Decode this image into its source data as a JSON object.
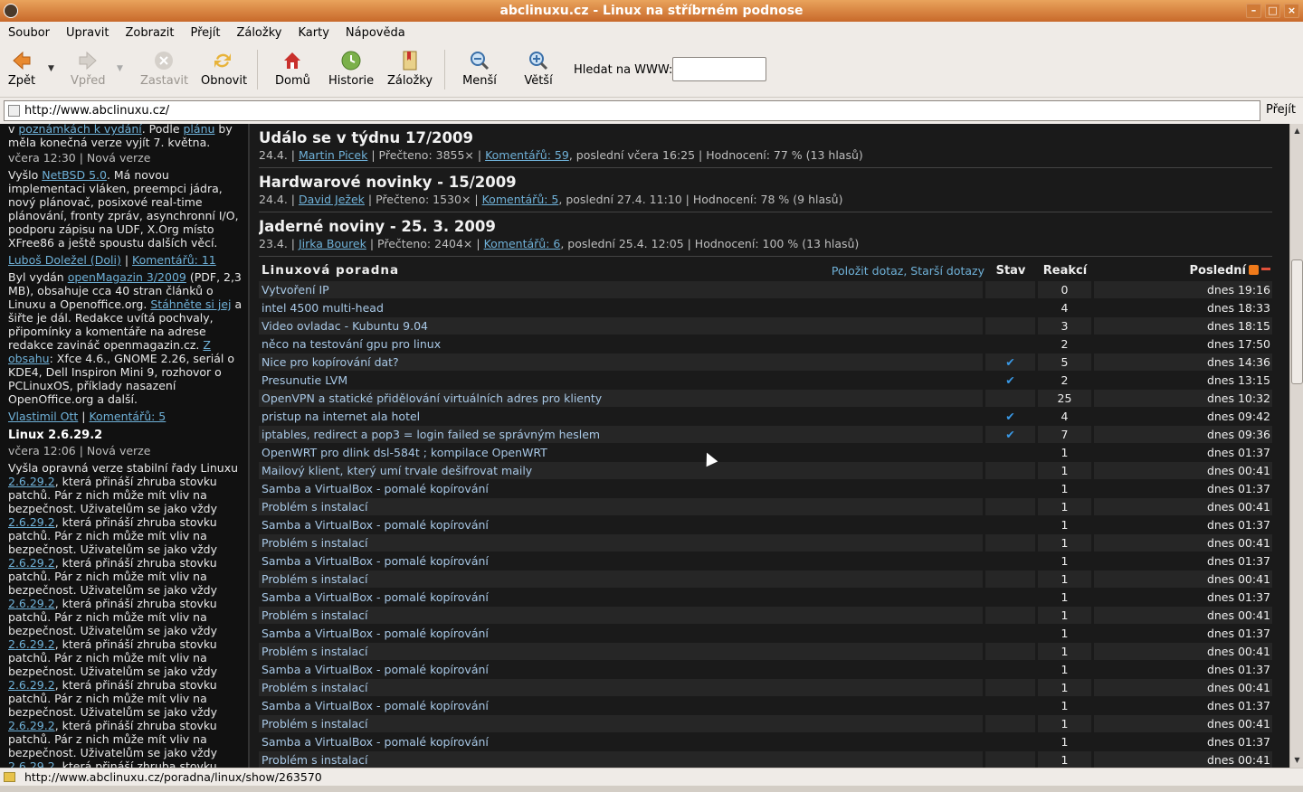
{
  "window": {
    "title": "abclinuxu.cz - Linux na stříbrném podnose"
  },
  "menu": [
    "Soubor",
    "Upravit",
    "Zobrazit",
    "Přejít",
    "Záložky",
    "Karty",
    "Nápověda"
  ],
  "toolbar": {
    "back": "Zpět",
    "forward": "Vpřed",
    "stop": "Zastavit",
    "reload": "Obnovit",
    "home": "Domů",
    "history": "Historie",
    "bookmarks": "Záložky",
    "zoom_out": "Menší",
    "zoom_in": "Větší",
    "search_label": "Hledat na WWW:"
  },
  "address": {
    "url": "http://www.abclinuxu.cz/",
    "go": "Přejít"
  },
  "sidebar": {
    "news1_text_a": "v ",
    "news1_link_a": "poznámkách k vydání",
    "news1_text_b": ". Podle ",
    "news1_link_b": "plánu",
    "news1_text_c": " by měla konečná verze vyjít 7. května.",
    "news1_meta": "včera 12:30 | Nová verze",
    "news2_text_a": "Vyšlo ",
    "news2_link": "NetBSD 5.0",
    "news2_text_b": ". Má novou implementaci vláken, preempci jádra, nový plánovač, posixové real-time plánování, fronty zpráv, asynchronní I/O, podporu zápisu na UDF, X.Org místo XFree86 a ještě spoustu dalších věcí.",
    "news2_author": "Luboš Doležel (Doli)",
    "news2_comments": "Komentářů: 11",
    "news3_text_a": "Byl vydán ",
    "news3_link_a": "openMagazin 3/2009",
    "news3_text_b": " (PDF, 2,3 MB), obsahuje cca 40 stran článků o Linuxu a Openoffice.org. ",
    "news3_link_b": "Stáhněte si jej",
    "news3_text_c": " a šiřte je dál. Redakce uvítá pochvaly, připomínky a komentáře na adrese redakce zavináč openmagazin.cz. ",
    "news3_link_c": "Z obsahu",
    "news3_text_d": ": Xfce 4.6., GNOME 2.26, seriál o KDE4, Dell Inspiron Mini 9, rozhovor o PCLinuxOS, příklady nasazení OpenOffice.org a další.",
    "news3_author": "Vlastimil Ott",
    "news3_comments": "Komentářů: 5",
    "news4_title": "Linux 2.6.29.2",
    "news4_meta": "včera 12:06 | Nová verze",
    "news4_text_a": "Vyšla opravná verze stabilní řady Linuxu ",
    "news4_link": "2.6.29.2",
    "news4_text_b": ", která přináší zhruba stovku patchů. Pár z nich může mít vliv na bezpečnost. Uživatelům se jako vždy"
  },
  "main": {
    "week_title": "Událo se v týdnu 17/2009",
    "articles": [
      {
        "meta_a": "24.4. | ",
        "author": "Martin Picek",
        "meta_b": " | Přečteno: 3855× | ",
        "comments": "Komentářů: 59",
        "meta_c": ", poslední včera 16:25 | Hodnocení: 77 % (13 hlasů)"
      },
      {
        "title": "Hardwarové novinky - 15/2009",
        "meta_a": "24.4. | ",
        "author": "David Ježek",
        "meta_b": " | Přečteno: 1530× | ",
        "comments": "Komentářů: 5",
        "meta_c": ", poslední 27.4. 11:10 | Hodnocení: 78 % (9 hlasů)"
      },
      {
        "title": "Jaderné noviny - 25. 3. 2009",
        "meta_a": "23.4. | ",
        "author": "Jirka Bourek",
        "meta_b": " | Přečteno: 2404× | ",
        "comments": "Komentářů: 6",
        "meta_c": ", poslední 25.4. 12:05 | Hodnocení: 100 % (13 hlasů)"
      }
    ],
    "forum": {
      "title": "Linuxová poradna",
      "ask": "Položit dotaz",
      "older": "Starší dotazy",
      "col_status": "Stav",
      "col_replies": "Reakcí",
      "col_last": "Poslední",
      "rows": [
        {
          "q": "Vytvoření IP",
          "st": "",
          "rc": "0",
          "t": "dnes 19:16"
        },
        {
          "q": "intel 4500 multi-head",
          "st": "",
          "rc": "4",
          "t": "dnes 18:33"
        },
        {
          "q": "Video ovladac - Kubuntu 9.04",
          "st": "",
          "rc": "3",
          "t": "dnes 18:15"
        },
        {
          "q": "něco na testování gpu pro linux",
          "st": "",
          "rc": "2",
          "t": "dnes 17:50"
        },
        {
          "q": "Nice pro kopírování dat?",
          "st": "✔",
          "rc": "5",
          "t": "dnes 14:36"
        },
        {
          "q": "Presunutie LVM",
          "st": "✔",
          "rc": "2",
          "t": "dnes 13:15"
        },
        {
          "q": "OpenVPN a statické přidělování virtuálních adres pro klienty",
          "st": "",
          "rc": "25",
          "t": "dnes 10:32"
        },
        {
          "q": "pristup na internet ala hotel",
          "st": "✔",
          "rc": "4",
          "t": "dnes 09:42"
        },
        {
          "q": "iptables, redirect a pop3 = login failed se správným heslem",
          "st": "✔",
          "rc": "7",
          "t": "dnes 09:36"
        },
        {
          "q": "OpenWRT pro dlink dsl-584t ; kompilace OpenWRT",
          "st": "",
          "rc": "1",
          "t": "dnes 01:37"
        },
        {
          "q": "Mailový klient, který umí trvale dešifrovat maily",
          "st": "",
          "rc": "1",
          "t": "dnes 00:41"
        },
        {
          "q": "Samba a VirtualBox - pomalé kopírování",
          "st": "",
          "rc": "1",
          "t": "dnes 01:37"
        },
        {
          "q": "Problém s instalací",
          "st": "",
          "rc": "1",
          "t": "dnes 00:41"
        },
        {
          "q": "Samba a VirtualBox - pomalé kopírování",
          "st": "",
          "rc": "1",
          "t": "dnes 01:37"
        },
        {
          "q": "Problém s instalací",
          "st": "",
          "rc": "1",
          "t": "dnes 00:41"
        },
        {
          "q": "Samba a VirtualBox - pomalé kopírování",
          "st": "",
          "rc": "1",
          "t": "dnes 01:37"
        },
        {
          "q": "Problém s instalací",
          "st": "",
          "rc": "1",
          "t": "dnes 00:41"
        },
        {
          "q": "Samba a VirtualBox - pomalé kopírování",
          "st": "",
          "rc": "1",
          "t": "dnes 01:37"
        },
        {
          "q": "Problém s instalací",
          "st": "",
          "rc": "1",
          "t": "dnes 00:41"
        },
        {
          "q": "Samba a VirtualBox - pomalé kopírování",
          "st": "",
          "rc": "1",
          "t": "dnes 01:37"
        },
        {
          "q": "Problém s instalací",
          "st": "",
          "rc": "1",
          "t": "dnes 00:41"
        },
        {
          "q": "Samba a VirtualBox - pomalé kopírování",
          "st": "",
          "rc": "1",
          "t": "dnes 01:37"
        },
        {
          "q": "Problém s instalací",
          "st": "",
          "rc": "1",
          "t": "dnes 00:41"
        },
        {
          "q": "Samba a VirtualBox - pomalé kopírování",
          "st": "",
          "rc": "1",
          "t": "dnes 01:37"
        },
        {
          "q": "Problém s instalací",
          "st": "",
          "rc": "1",
          "t": "dnes 00:41"
        },
        {
          "q": "Samba a VirtualBox - pomalé kopírování",
          "st": "",
          "rc": "1",
          "t": "dnes 01:37"
        },
        {
          "q": "Problém s instalací",
          "st": "",
          "rc": "1",
          "t": "dnes 00:41"
        }
      ]
    }
  },
  "status": {
    "text": "http://www.abclinuxu.cz/poradna/linux/show/263570"
  },
  "colors": {
    "titlebar": "#d27b36",
    "link": "#6fb1d8",
    "bg": "#111111"
  }
}
